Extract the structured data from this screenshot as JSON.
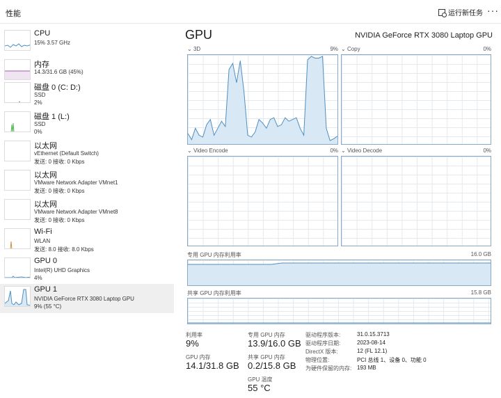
{
  "header": {
    "title": "性能",
    "run_task": "运行新任务",
    "more": "···"
  },
  "sidebar": {
    "items": [
      {
        "name": "CPU",
        "sub1": "15%  3.57 GHz",
        "sub2": ""
      },
      {
        "name": "内存",
        "sub1": "14.3/31.6 GB (45%)",
        "sub2": ""
      },
      {
        "name": "磁盘 0 (C: D:)",
        "sub1": "SSD",
        "sub2": "2%"
      },
      {
        "name": "磁盘 1 (L:)",
        "sub1": "SSD",
        "sub2": "0%"
      },
      {
        "name": "以太网",
        "sub1": "vEthernet (Default Switch)",
        "sub2": "发送: 0  接收: 0 Kbps"
      },
      {
        "name": "以太网",
        "sub1": "VMware Network Adapter VMnet1",
        "sub2": "发送: 0  接收: 0 Kbps"
      },
      {
        "name": "以太网",
        "sub1": "VMware Network Adapter VMnet8",
        "sub2": "发送: 0  接收: 0 Kbps"
      },
      {
        "name": "Wi-Fi",
        "sub1": "WLAN",
        "sub2": "发送: 8.0  接收: 8.0 Kbps"
      },
      {
        "name": "GPU 0",
        "sub1": "Intel(R) UHD Graphics",
        "sub2": "4%"
      },
      {
        "name": "GPU 1",
        "sub1": "NVIDIA GeForce RTX 3080 Laptop GPU",
        "sub2": "9% (55 °C)"
      }
    ]
  },
  "main": {
    "title": "GPU",
    "model": "NVIDIA GeForce RTX 3080 Laptop GPU",
    "graphs": {
      "g3d": {
        "label": "3D",
        "pct": "9%"
      },
      "copy": {
        "label": "Copy",
        "pct": "0%"
      },
      "encode": {
        "label": "Video Encode",
        "pct": "0%"
      },
      "decode": {
        "label": "Video Decode",
        "pct": "0%"
      },
      "dedicated": {
        "label": "专用 GPU 内存利用率",
        "max": "16.0 GB"
      },
      "shared": {
        "label": "共享 GPU 内存利用率",
        "max": "15.8 GB"
      }
    },
    "stats": {
      "util_label": "利用率",
      "util_value": "9%",
      "gpu_mem_label": "GPU 内存",
      "gpu_mem_value": "14.1/31.8 GB",
      "dedicated_label": "专用 GPU 内存",
      "dedicated_value": "13.9/16.0 GB",
      "shared_label": "共享 GPU 内存",
      "shared_value": "0.2/15.8 GB",
      "temp_label": "GPU 温度",
      "temp_value": "55 °C"
    },
    "info": [
      {
        "label": "驱动程序版本:",
        "value": "31.0.15.3713"
      },
      {
        "label": "驱动程序日期:",
        "value": "2023-08-14"
      },
      {
        "label": "DirectX 版本:",
        "value": "12 (FL 12.1)"
      },
      {
        "label": "物理位置:",
        "value": "PCI 总线 1、设备 0、功能 0"
      },
      {
        "label": "为硬件保留的内存:",
        "value": "193 MB"
      }
    ]
  },
  "chart_data": {
    "type": "area",
    "title": "3D",
    "ylim": [
      0,
      100
    ],
    "series": [
      {
        "values": [
          12,
          5,
          18,
          10,
          8,
          22,
          28,
          10,
          18,
          26,
          20,
          85,
          92,
          70,
          95,
          60,
          10,
          8,
          14,
          28,
          24,
          18,
          28,
          30,
          20,
          22,
          30,
          26,
          28,
          30,
          18,
          10,
          96,
          100,
          98,
          98,
          100,
          18,
          4,
          6,
          9
        ]
      }
    ]
  },
  "colors": {
    "accent": "#4f8fc0",
    "fill": "#d9e8f5",
    "mem": "#a35ea8",
    "disk": "#5cb85c",
    "wifi": "#d88b3a"
  }
}
